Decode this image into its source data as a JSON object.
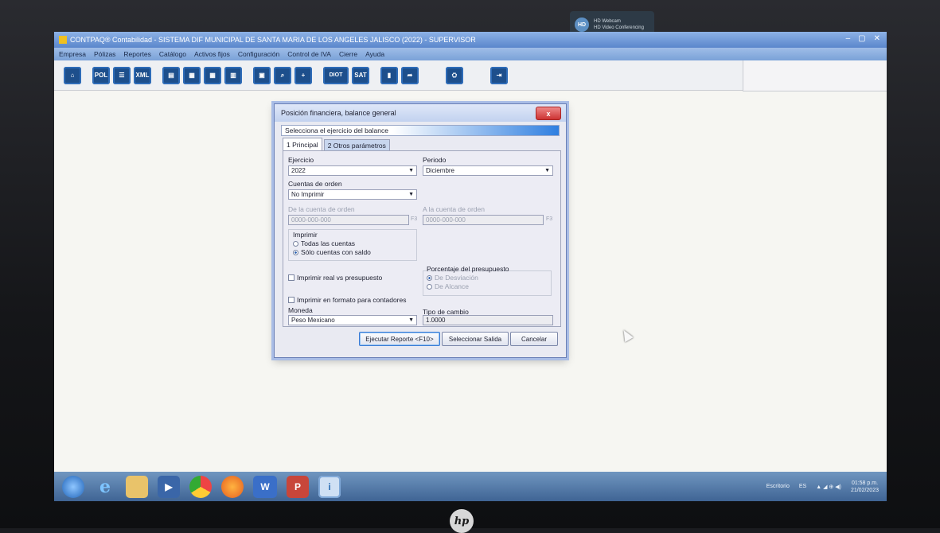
{
  "webcam_badge": {
    "line1": "HD Webcam",
    "line2": "HD Video Conferencing"
  },
  "window": {
    "title": "CONTPAQ® Contabilidad - SISTEMA DIF MUNICIPAL DE SANTA MARIA DE LOS ANGELES JALISCO (2022) - SUPERVISOR",
    "controls": {
      "minimize": "–",
      "maximize": "▢",
      "close": "✕"
    }
  },
  "menu": [
    "Empresa",
    "Pólizas",
    "Reportes",
    "Catálogo",
    "Activos fijos",
    "Configuración",
    "Control de IVA",
    "Cierre",
    "Ayuda"
  ],
  "toolbar": {
    "home_icon": "⌂",
    "pol_label": "POL",
    "xml_label": "XML",
    "diot_label": "DIOT",
    "sat_label": "SAT",
    "plus_icon": "+",
    "exit_icon": "⇥",
    "person_icon": "⛭"
  },
  "dialog": {
    "title": "Posición financiera, balance general",
    "close_label": "x",
    "subtitle": "Selecciona el ejercicio del balance",
    "tabs": [
      "1 Principal",
      "2 Otros parámetros"
    ],
    "ejercicio": {
      "label": "Ejercicio",
      "value": "2022"
    },
    "periodo": {
      "label": "Periodo",
      "value": "Diciembre"
    },
    "cuentas_orden": {
      "label": "Cuentas de orden",
      "value": "No Imprimir"
    },
    "de_cuenta": {
      "label": "De la cuenta de orden",
      "value": "0000-000-000",
      "key": "F3"
    },
    "a_cuenta": {
      "label": "A la cuenta de orden",
      "value": "0000-000-000",
      "key": "F3"
    },
    "imprimir": {
      "label": "Imprimir",
      "opt1": "Todas las cuentas",
      "opt2": "Sólo cuentas con saldo"
    },
    "real_vs_presupuesto": "Imprimir real vs presupuesto",
    "porcentaje": {
      "label": "Porcentaje del presupuesto",
      "opt1": "De Desviación",
      "opt2": "De Alcance"
    },
    "formato_contadores": "Imprimir en formato para contadores",
    "moneda": {
      "label": "Moneda",
      "value": "Peso Mexicano"
    },
    "tipo_cambio": {
      "label": "Tipo de cambio",
      "value": "1.0000"
    },
    "buttons": {
      "run": "Ejecutar Reporte <F10>",
      "output": "Seleccionar Salida",
      "cancel": "Cancelar"
    }
  },
  "taskbar": {
    "ie_glyph": "e",
    "media_glyph": "▶",
    "word_glyph": "W",
    "ppt_glyph": "P",
    "contpaq_glyph": "i",
    "tray": {
      "desktop": "Escritorio",
      "lang": "ES",
      "icons": "▲ ◢ ⊕ ◀)",
      "time": "01:58 p.m.",
      "date": "21/02/2023"
    }
  },
  "brand": "hp"
}
